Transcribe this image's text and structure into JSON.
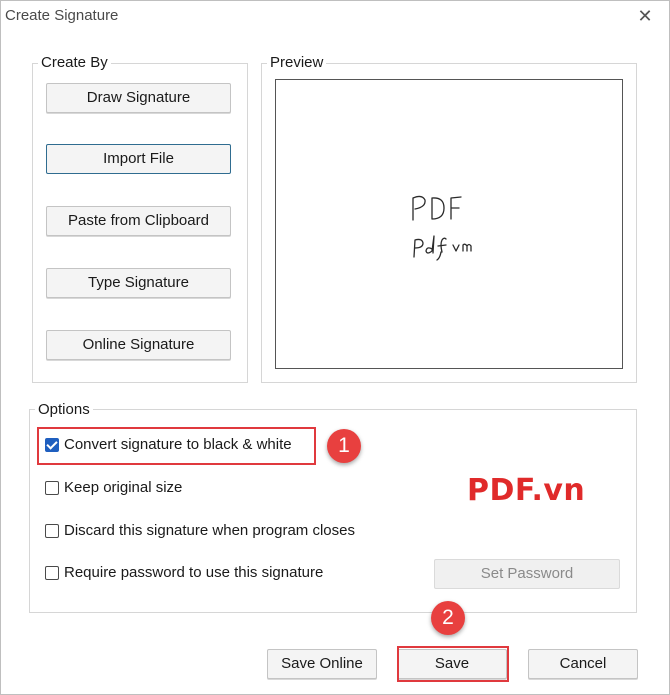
{
  "window": {
    "title": "Create Signature",
    "close_icon": "close-icon"
  },
  "create_by": {
    "label": "Create By",
    "buttons": [
      "Draw Signature",
      "Import File",
      "Paste from Clipboard",
      "Type Signature",
      "Online Signature"
    ]
  },
  "preview": {
    "label": "Preview",
    "handwriting_line1": "PDF",
    "handwriting_line2": "Pdf vn"
  },
  "options": {
    "label": "Options",
    "items": [
      {
        "label": "Convert signature to black & white",
        "checked": true
      },
      {
        "label": "Keep original size",
        "checked": false
      },
      {
        "label": "Discard this signature when program closes",
        "checked": false
      },
      {
        "label": "Require password to use this signature",
        "checked": false
      }
    ],
    "set_password": "Set Password"
  },
  "footer": {
    "save_online": "Save Online",
    "save": "Save",
    "cancel": "Cancel"
  },
  "annotations": {
    "badge1": "1",
    "badge2": "2",
    "highlight_color": "#e0393e",
    "watermark": "PDF.vn"
  }
}
